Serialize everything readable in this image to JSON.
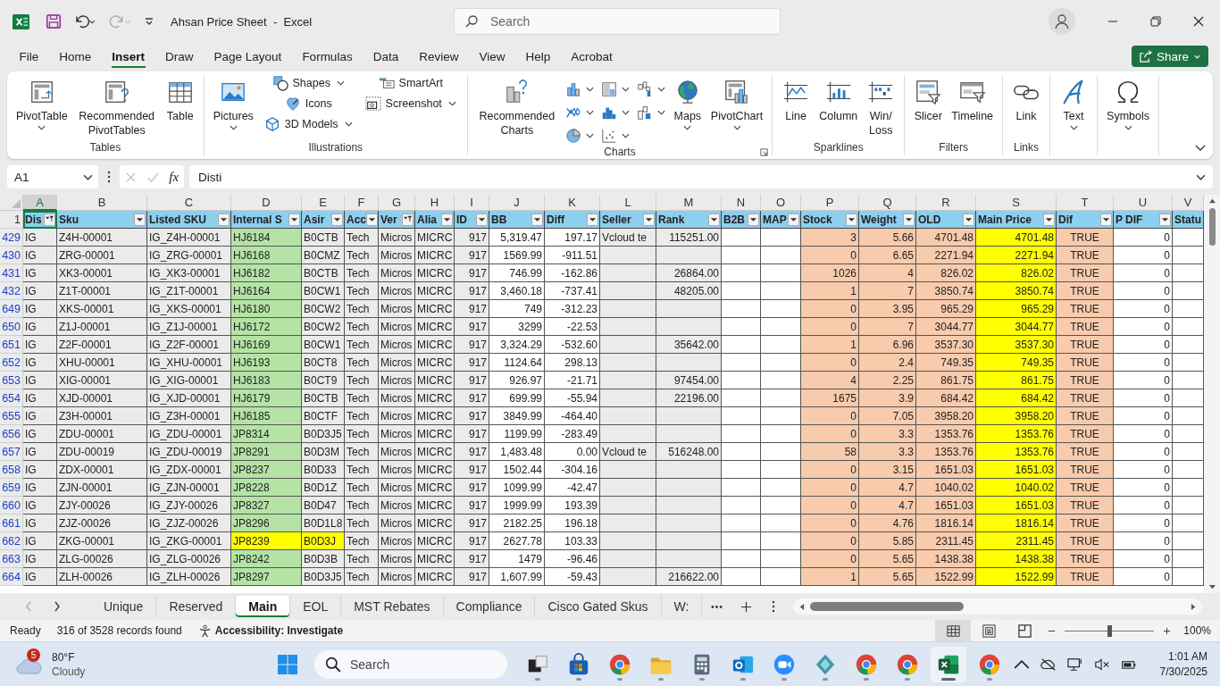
{
  "title_bar": {
    "title": "Ahsan Price Sheet  -  Excel",
    "search": {
      "placeholder": "Search"
    }
  },
  "menu_tabs": [
    {
      "label": "File",
      "selected": false
    },
    {
      "label": "Home",
      "selected": false
    },
    {
      "label": "Insert",
      "selected": true
    },
    {
      "label": "Draw",
      "selected": false
    },
    {
      "label": "Page Layout",
      "selected": false
    },
    {
      "label": "Formulas",
      "selected": false
    },
    {
      "label": "Data",
      "selected": false
    },
    {
      "label": "Review",
      "selected": false
    },
    {
      "label": "View",
      "selected": false
    },
    {
      "label": "Help",
      "selected": false
    },
    {
      "label": "Acrobat",
      "selected": false
    }
  ],
  "share_button": "Share",
  "ribbon": [
    {
      "label": "Tables",
      "items": [
        {
          "label": "PivotTable",
          "kind": "large",
          "dropdown": true
        },
        {
          "label": "Recommended PivotTables",
          "kind": "large",
          "dropdown": false
        },
        {
          "label": "Table",
          "kind": "large",
          "dropdown": false
        }
      ]
    },
    {
      "label": "Illustrations",
      "items": [
        {
          "label": "Pictures",
          "kind": "large",
          "dropdown": true
        },
        {
          "label": "Shapes",
          "kind": "small",
          "dropdown": true
        },
        {
          "label": "Icons",
          "kind": "small",
          "dropdown": false
        },
        {
          "label": "3D Models",
          "kind": "small",
          "dropdown": true
        },
        {
          "label": "SmartArt",
          "kind": "small",
          "dropdown": false
        },
        {
          "label": "Screenshot",
          "kind": "small",
          "dropdown": true
        }
      ]
    },
    {
      "label": "Charts",
      "items": [
        {
          "label": "Recommended Charts",
          "kind": "large",
          "dropdown": false
        },
        {
          "kind": "icon",
          "dropdown": true
        },
        {
          "kind": "icon",
          "dropdown": true
        },
        {
          "kind": "icon",
          "dropdown": true
        },
        {
          "kind": "icon",
          "dropdown": true
        },
        {
          "kind": "icon",
          "dropdown": true
        },
        {
          "kind": "icon",
          "dropdown": true
        },
        {
          "kind": "icon",
          "dropdown": true
        },
        {
          "kind": "icon",
          "dropdown": true
        },
        {
          "label": "Maps",
          "kind": "large",
          "dropdown": true
        },
        {
          "label": "PivotChart",
          "kind": "large",
          "dropdown": true
        }
      ]
    },
    {
      "label": "Sparklines",
      "items": [
        {
          "label": "Line",
          "kind": "large",
          "dropdown": false
        },
        {
          "label": "Column",
          "kind": "large",
          "dropdown": false
        },
        {
          "label": "Win/Loss",
          "kind": "large",
          "dropdown": false
        }
      ]
    },
    {
      "label": "Filters",
      "items": [
        {
          "label": "Slicer",
          "kind": "large",
          "dropdown": false
        },
        {
          "label": "Timeline",
          "kind": "large",
          "dropdown": false
        }
      ]
    },
    {
      "label": "Links",
      "items": [
        {
          "label": "Link",
          "kind": "large",
          "dropdown": false
        }
      ]
    },
    {
      "items": [
        {
          "label": "Text",
          "kind": "large",
          "dropdown": true
        }
      ]
    },
    {
      "items": [
        {
          "label": "Symbols",
          "kind": "large",
          "dropdown": true
        }
      ]
    }
  ],
  "formula_bar": {
    "name_box": "A1",
    "function_label": "fx",
    "formula": "Disti"
  },
  "sheet": {
    "column_letters": [
      {
        "label": "A",
        "selected": true
      },
      {
        "label": "B",
        "selected": false
      },
      {
        "label": "C",
        "selected": false
      },
      {
        "label": "D",
        "selected": false
      },
      {
        "label": "E",
        "selected": false
      },
      {
        "label": "F",
        "selected": false
      },
      {
        "label": "G",
        "selected": false
      },
      {
        "label": "H",
        "selected": false
      },
      {
        "label": "I",
        "selected": false
      },
      {
        "label": "J",
        "selected": false
      },
      {
        "label": "K",
        "selected": false
      },
      {
        "label": "L",
        "selected": false
      },
      {
        "label": "M",
        "selected": false
      },
      {
        "label": "N",
        "selected": false
      },
      {
        "label": "O",
        "selected": false
      },
      {
        "label": "P",
        "selected": false
      },
      {
        "label": "Q",
        "selected": false
      },
      {
        "label": "R",
        "selected": false
      },
      {
        "label": "S",
        "selected": false
      },
      {
        "label": "T",
        "selected": false
      },
      {
        "label": "U",
        "selected": false
      },
      {
        "label": "V",
        "selected": false
      }
    ],
    "header_row_number": "1",
    "columns": [
      {
        "label": "Dis",
        "kind": "text",
        "dropdown": true,
        "filtered": true,
        "color": "#ebebeb"
      },
      {
        "label": "Sku",
        "kind": "text",
        "dropdown": true,
        "filtered": false,
        "color": "#ebebeb"
      },
      {
        "label": "Listed SKU",
        "kind": "text",
        "dropdown": true,
        "filtered": false,
        "color": "#ebebeb"
      },
      {
        "label": "Internal S",
        "kind": "text",
        "dropdown": true,
        "filtered": false,
        "color": "#b5e3a5"
      },
      {
        "label": "Asir",
        "kind": "text",
        "dropdown": true,
        "filtered": false,
        "color": "#ebebeb"
      },
      {
        "label": "Acc",
        "kind": "text",
        "dropdown": true,
        "filtered": false,
        "color": "#ebebeb"
      },
      {
        "label": "Ver",
        "kind": "text",
        "dropdown": true,
        "filtered": true,
        "color": "#ebebeb"
      },
      {
        "label": "Alia",
        "kind": "text",
        "dropdown": true,
        "filtered": false,
        "color": "#ebebeb"
      },
      {
        "label": "ID",
        "kind": "number",
        "dropdown": true,
        "filtered": false,
        "color": "#ebebeb"
      },
      {
        "label": "BB",
        "kind": "number",
        "dropdown": true,
        "filtered": false,
        "color": "#ffffff"
      },
      {
        "label": "Diff",
        "kind": "number",
        "dropdown": true,
        "filtered": false,
        "color": "#ffffff"
      },
      {
        "label": "Seller",
        "kind": "text",
        "dropdown": true,
        "filtered": false,
        "color": "#ebebeb"
      },
      {
        "label": "Rank",
        "kind": "number",
        "dropdown": true,
        "filtered": false,
        "color": "#ebebeb"
      },
      {
        "label": "B2B",
        "kind": "text",
        "dropdown": true,
        "filtered": false,
        "color": "#ffffff"
      },
      {
        "label": "MAP",
        "kind": "text",
        "dropdown": true,
        "filtered": false,
        "color": "#ffffff"
      },
      {
        "label": "Stock",
        "kind": "number",
        "dropdown": true,
        "filtered": false,
        "color": "#f8cbad"
      },
      {
        "label": "Weight",
        "kind": "number",
        "dropdown": true,
        "filtered": false,
        "color": "#f8cbad"
      },
      {
        "label": "OLD",
        "kind": "number",
        "dropdown": true,
        "filtered": false,
        "color": "#f8cbad"
      },
      {
        "label": "Main Price",
        "kind": "number",
        "dropdown": true,
        "filtered": false,
        "color": "#ffff00"
      },
      {
        "label": "Dif",
        "kind": "center",
        "dropdown": true,
        "filtered": false,
        "color": "#f8cbad"
      },
      {
        "label": "P DIF",
        "kind": "number",
        "dropdown": true,
        "filtered": false,
        "color": "#ffffff"
      },
      {
        "label": "Statu",
        "kind": "text",
        "dropdown": false,
        "color": "#ffffff"
      }
    ],
    "rows": [
      {
        "number": "429",
        "cells": [
          "IG",
          "Z4H-00001",
          "IG_Z4H-00001",
          "HJ6184",
          "B0CTB",
          "Tech",
          "Micros",
          "MICRC",
          "917",
          "5,319.47",
          "197.17",
          "Vcloud te",
          "115251.00",
          null,
          null,
          "3",
          "5.66",
          "4701.48",
          "4701.48",
          "TRUE",
          "0",
          null
        ]
      },
      {
        "number": "430",
        "cells": [
          "IG",
          "ZRG-00001",
          "IG_ZRG-00001",
          "HJ6168",
          "B0CMZ",
          "Tech",
          "Micros",
          "MICRC",
          "917",
          "1569.99",
          "-911.51",
          null,
          null,
          null,
          null,
          "0",
          "6.65",
          "2271.94",
          "2271.94",
          "TRUE",
          "0",
          null
        ]
      },
      {
        "number": "431",
        "cells": [
          "IG",
          "XK3-00001",
          "IG_XK3-00001",
          "HJ6182",
          "B0CTB",
          "Tech",
          "Micros",
          "MICRC",
          "917",
          "746.99",
          "-162.86",
          null,
          "26864.00",
          null,
          null,
          "1026",
          "4",
          "826.02",
          "826.02",
          "TRUE",
          "0",
          null
        ]
      },
      {
        "number": "432",
        "cells": [
          "IG",
          "Z1T-00001",
          "IG_Z1T-00001",
          "HJ6164",
          "B0CW1",
          "Tech",
          "Micros",
          "MICRC",
          "917",
          "3,460.18",
          "-737.41",
          null,
          "48205.00",
          null,
          null,
          "1",
          "7",
          "3850.74",
          "3850.74",
          "TRUE",
          "0",
          null
        ]
      },
      {
        "number": "649",
        "cells": [
          "IG",
          "XKS-00001",
          "IG_XKS-00001",
          "HJ6180",
          "B0CW2",
          "Tech",
          "Micros",
          "MICRC",
          "917",
          "749",
          "-312.23",
          null,
          null,
          null,
          null,
          "0",
          "3.95",
          "965.29",
          "965.29",
          "TRUE",
          "0",
          null
        ]
      },
      {
        "number": "650",
        "cells": [
          "IG",
          "Z1J-00001",
          "IG_Z1J-00001",
          "HJ6172",
          "B0CW2",
          "Tech",
          "Micros",
          "MICRC",
          "917",
          "3299",
          "-22.53",
          null,
          null,
          null,
          null,
          "0",
          "7",
          "3044.77",
          "3044.77",
          "TRUE",
          "0",
          null
        ]
      },
      {
        "number": "651",
        "cells": [
          "IG",
          "Z2F-00001",
          "IG_Z2F-00001",
          "HJ6169",
          "B0CW1",
          "Tech",
          "Micros",
          "MICRC",
          "917",
          "3,324.29",
          "-532.60",
          null,
          "35642.00",
          null,
          null,
          "1",
          "6.96",
          "3537.30",
          "3537.30",
          "TRUE",
          "0",
          null
        ]
      },
      {
        "number": "652",
        "cells": [
          "IG",
          "XHU-00001",
          "IG_XHU-00001",
          "HJ6193",
          "B0CT8",
          "Tech",
          "Micros",
          "MICRC",
          "917",
          "1124.64",
          "298.13",
          null,
          null,
          null,
          null,
          "0",
          "2.4",
          "749.35",
          "749.35",
          "TRUE",
          "0",
          null
        ]
      },
      {
        "number": "653",
        "cells": [
          "IG",
          "XIG-00001",
          "IG_XIG-00001",
          "HJ6183",
          "B0CT9",
          "Tech",
          "Micros",
          "MICRC",
          "917",
          "926.97",
          "-21.71",
          null,
          "97454.00",
          null,
          null,
          "4",
          "2.25",
          "861.75",
          "861.75",
          "TRUE",
          "0",
          null
        ]
      },
      {
        "number": "654",
        "cells": [
          "IG",
          "XJD-00001",
          "IG_XJD-00001",
          "HJ6179",
          "B0CTB",
          "Tech",
          "Micros",
          "MICRC",
          "917",
          "699.99",
          "-55.94",
          null,
          "22196.00",
          null,
          null,
          "1675",
          "3.9",
          "684.42",
          "684.42",
          "TRUE",
          "0",
          null
        ]
      },
      {
        "number": "655",
        "cells": [
          "IG",
          "Z3H-00001",
          "IG_Z3H-00001",
          "HJ6185",
          "B0CTF",
          "Tech",
          "Micros",
          "MICRC",
          "917",
          "3849.99",
          "-464.40",
          null,
          null,
          null,
          null,
          "0",
          "7.05",
          "3958.20",
          "3958.20",
          "TRUE",
          "0",
          null
        ]
      },
      {
        "number": "656",
        "cells": [
          "IG",
          "ZDU-00001",
          "IG_ZDU-00001",
          "JP8314",
          "B0D3J5",
          "Tech",
          "Micros",
          "MICRC",
          "917",
          "1199.99",
          "-283.49",
          null,
          null,
          null,
          null,
          "0",
          "3.3",
          "1353.76",
          "1353.76",
          "TRUE",
          "0",
          null
        ]
      },
      {
        "number": "657",
        "cells": [
          "IG",
          "ZDU-00019",
          "IG_ZDU-00019",
          "JP8291",
          "B0D3M",
          "Tech",
          "Micros",
          "MICRC",
          "917",
          "1,483.48",
          "0.00",
          "Vcloud te",
          "516248.00",
          null,
          null,
          "58",
          "3.3",
          "1353.76",
          "1353.76",
          "TRUE",
          "0",
          null
        ]
      },
      {
        "number": "658",
        "cells": [
          "IG",
          "ZDX-00001",
          "IG_ZDX-00001",
          "JP8237",
          "B0D33",
          "Tech",
          "Micros",
          "MICRC",
          "917",
          "1502.44",
          "-304.16",
          null,
          null,
          null,
          null,
          "0",
          "3.15",
          "1651.03",
          "1651.03",
          "TRUE",
          "0",
          null
        ]
      },
      {
        "number": "659",
        "cells": [
          "IG",
          "ZJN-00001",
          "IG_ZJN-00001",
          "JP8228",
          "B0D1Z",
          "Tech",
          "Micros",
          "MICRC",
          "917",
          "1099.99",
          "-42.47",
          null,
          null,
          null,
          null,
          "0",
          "4.7",
          "1040.02",
          "1040.02",
          "TRUE",
          "0",
          null
        ]
      },
      {
        "number": "660",
        "cells": [
          "IG",
          "ZJY-00026",
          "IG_ZJY-00026",
          "JP8327",
          "B0D47",
          "Tech",
          "Micros",
          "MICRC",
          "917",
          "1999.99",
          "193.39",
          null,
          null,
          null,
          null,
          "0",
          "4.7",
          "1651.03",
          "1651.03",
          "TRUE",
          "0",
          null
        ]
      },
      {
        "number": "661",
        "cells": [
          "IG",
          "ZJZ-00026",
          "IG_ZJZ-00026",
          "JP8296",
          "B0D1L8",
          "Tech",
          "Micros",
          "MICRC",
          "917",
          "2182.25",
          "196.18",
          null,
          null,
          null,
          null,
          "0",
          "4.76",
          "1816.14",
          "1816.14",
          "TRUE",
          "0",
          null
        ]
      },
      {
        "number": "662",
        "cells": [
          "IG",
          "ZKG-00001",
          "IG_ZKG-00001",
          {
            "text": "JP8239",
            "highlighted": true
          },
          {
            "text": "B0D3J",
            "highlighted": true
          },
          "Tech",
          "Micros",
          "MICRC",
          "917",
          "2627.78",
          "103.33",
          null,
          null,
          null,
          null,
          "0",
          "5.85",
          "2311.45",
          "2311.45",
          "TRUE",
          "0",
          null
        ]
      },
      {
        "number": "663",
        "cells": [
          "IG",
          "ZLG-00026",
          "IG_ZLG-00026",
          "JP8242",
          "B0D3B",
          "Tech",
          "Micros",
          "MICRC",
          "917",
          "1479",
          "-96.46",
          null,
          null,
          null,
          null,
          "0",
          "5.65",
          "1438.38",
          "1438.38",
          "TRUE",
          "0",
          null
        ]
      },
      {
        "number": "664",
        "cells": [
          "IG",
          "ZLH-00026",
          "IG_ZLH-00026",
          "JP8297",
          "B0D3J5",
          "Tech",
          "Micros",
          "MICRC",
          "917",
          "1,607.99",
          "-59.43",
          null,
          "216622.00",
          null,
          null,
          "1",
          "5.65",
          "1522.99",
          "1522.99",
          "TRUE",
          "0",
          null
        ]
      }
    ]
  },
  "sheet_tabs": [
    {
      "label": "Unique",
      "selected": false
    },
    {
      "label": "Reserved",
      "selected": false
    },
    {
      "label": "Main",
      "selected": true
    },
    {
      "label": "EOL",
      "selected": false
    },
    {
      "label": "MST Rebates",
      "selected": false
    },
    {
      "label": "Compliance",
      "selected": false
    },
    {
      "label": "Cisco Gated Skus",
      "selected": false
    },
    {
      "label": "W:",
      "selected": false
    }
  ],
  "status_bar": {
    "status": "Ready",
    "records": "316 of 3528 records found",
    "accessibility": "Accessibility: Investigate",
    "views": [
      {
        "kind": "normal",
        "selected": true
      },
      {
        "kind": "page_layout",
        "selected": false
      },
      {
        "kind": "page_break",
        "selected": false
      }
    ],
    "zoom": {
      "level": 0.5,
      "reading": "100%"
    }
  },
  "taskbar": {
    "weather": {
      "badge": "5",
      "temperature": "80°F",
      "condition": "Cloudy"
    },
    "search": {
      "placeholder": "Search"
    },
    "apps": [
      {
        "kind": "task_view",
        "active": false
      },
      {
        "kind": "store",
        "active": false
      },
      {
        "kind": "chrome",
        "active": false
      },
      {
        "kind": "folder",
        "active": false
      },
      {
        "kind": "calculator",
        "active": false
      },
      {
        "kind": "outlook",
        "active": false
      },
      {
        "kind": "zoom",
        "active": false
      },
      {
        "kind": "diamond",
        "active": false
      },
      {
        "kind": "chrome",
        "active": false
      },
      {
        "kind": "chrome",
        "active": false
      },
      {
        "kind": "excel",
        "active": true
      },
      {
        "kind": "chrome",
        "active": false
      }
    ],
    "clock": {
      "time": "1:01 AM",
      "date": "7/30/2025"
    }
  }
}
